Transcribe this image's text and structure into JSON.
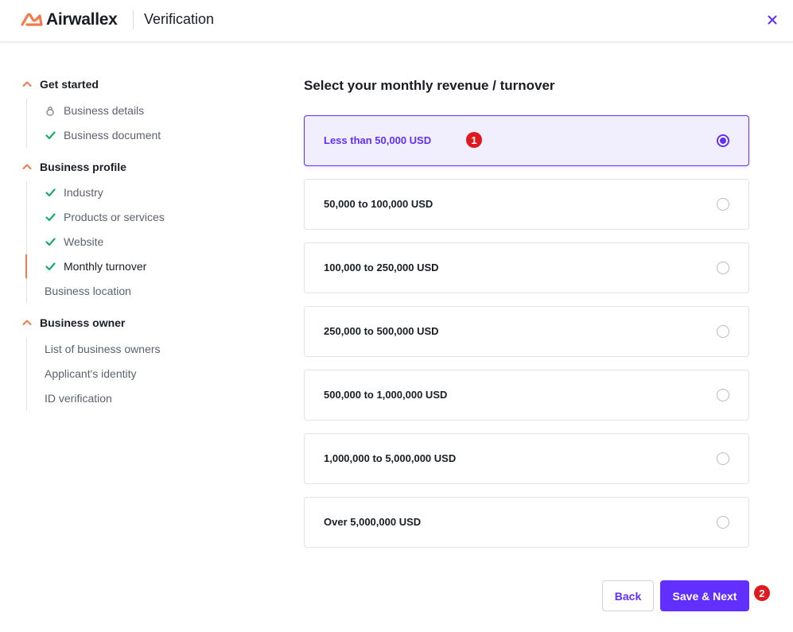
{
  "header": {
    "brand": "Airwallex",
    "title": "Verification",
    "close_icon": "close-icon"
  },
  "sidebar": {
    "sections": [
      {
        "label": "Get started",
        "steps": [
          {
            "label": "Business details",
            "status": "locked",
            "icon": "lock-icon"
          },
          {
            "label": "Business document",
            "status": "done",
            "icon": "check-icon"
          }
        ]
      },
      {
        "label": "Business profile",
        "steps": [
          {
            "label": "Industry",
            "status": "done",
            "icon": "check-icon"
          },
          {
            "label": "Products or services",
            "status": "done",
            "icon": "check-icon"
          },
          {
            "label": "Website",
            "status": "done",
            "icon": "check-icon"
          },
          {
            "label": "Monthly turnover",
            "status": "current",
            "icon": "check-icon"
          },
          {
            "label": "Business location",
            "status": "pending",
            "icon": ""
          }
        ]
      },
      {
        "label": "Business owner",
        "steps": [
          {
            "label": "List of business owners",
            "status": "pending",
            "icon": ""
          },
          {
            "label": "Applicant's identity",
            "status": "pending",
            "icon": ""
          },
          {
            "label": "ID verification",
            "status": "pending",
            "icon": ""
          }
        ]
      }
    ]
  },
  "main": {
    "title": "Select your monthly revenue / turnover",
    "options": [
      {
        "label": "Less than 50,000 USD",
        "selected": true
      },
      {
        "label": "50,000 to 100,000 USD",
        "selected": false
      },
      {
        "label": "100,000 to 250,000 USD",
        "selected": false
      },
      {
        "label": "250,000 to 500,000 USD",
        "selected": false
      },
      {
        "label": "500,000 to 1,000,000 USD",
        "selected": false
      },
      {
        "label": "1,000,000 to 5,000,000 USD",
        "selected": false
      },
      {
        "label": "Over 5,000,000 USD",
        "selected": false
      }
    ],
    "back_label": "Back",
    "next_label": "Save & Next"
  },
  "annotations": {
    "badge_1": "1",
    "badge_2": "2"
  },
  "colors": {
    "accent": "#612fff",
    "brand_orange": "#f37a4c",
    "check_green": "#1aaa6a",
    "badge_red": "#e0191f"
  }
}
